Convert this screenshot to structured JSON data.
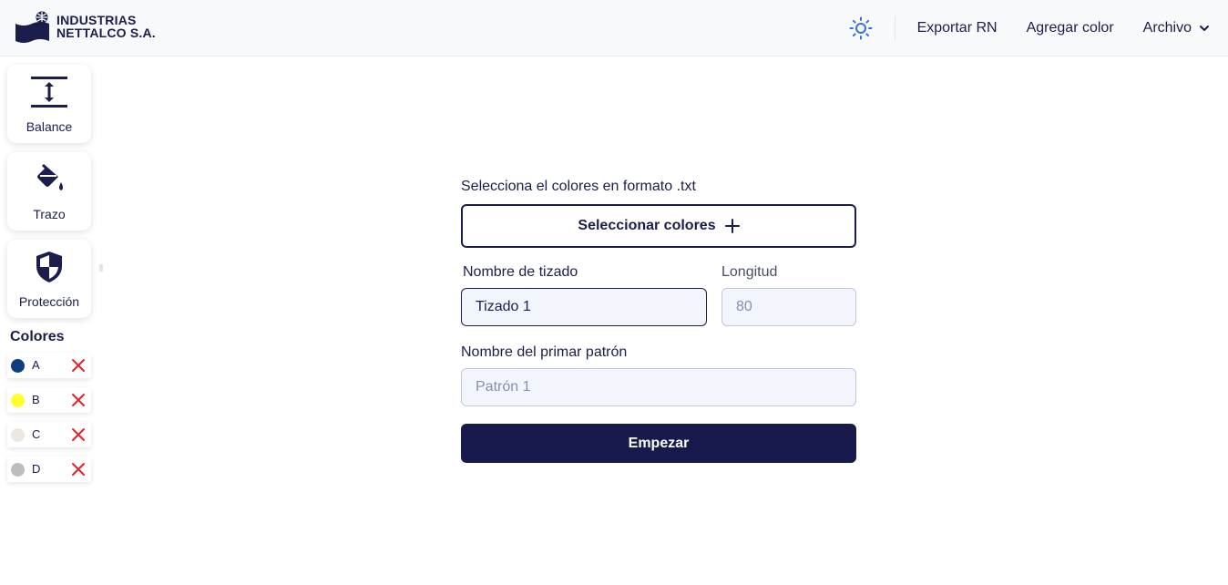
{
  "header": {
    "company_line1": "INDUSTRIAS",
    "company_line2": "NETTALCO S.A.",
    "theme_icon": "sun-icon",
    "nav": {
      "export": "Exportar RN",
      "add_color": "Agregar color",
      "file": "Archivo"
    }
  },
  "sidebar": {
    "tools": [
      {
        "label": "Balance",
        "icon": "balance-icon"
      },
      {
        "label": "Trazo",
        "icon": "paint-bucket-icon"
      },
      {
        "label": "Protección",
        "icon": "shield-icon"
      }
    ],
    "colors_title": "Colores",
    "colors": [
      {
        "name": "A",
        "color": "#0d3f7f"
      },
      {
        "name": "B",
        "color": "#ffff2e"
      },
      {
        "name": "C",
        "color": "#ece8e1"
      },
      {
        "name": "D",
        "color": "#bdbdbd"
      }
    ],
    "delete_color": "#e5222a"
  },
  "form": {
    "file_label": "Selecciona el colores en formato .txt",
    "select_button": "Seleccionar colores",
    "select_icon": "plus-icon",
    "name_label": "Nombre de tizado",
    "name_value": "Tizado 1",
    "length_label": "Longitud",
    "length_value": "80",
    "pattern_label": "Nombre del primar patrón",
    "pattern_placeholder": "Patrón 1",
    "start_button": "Empezar"
  },
  "colors": {
    "primary": "#171a4a",
    "input_bg": "#f3f5fd",
    "accent_icon": "#3b6fd8"
  }
}
